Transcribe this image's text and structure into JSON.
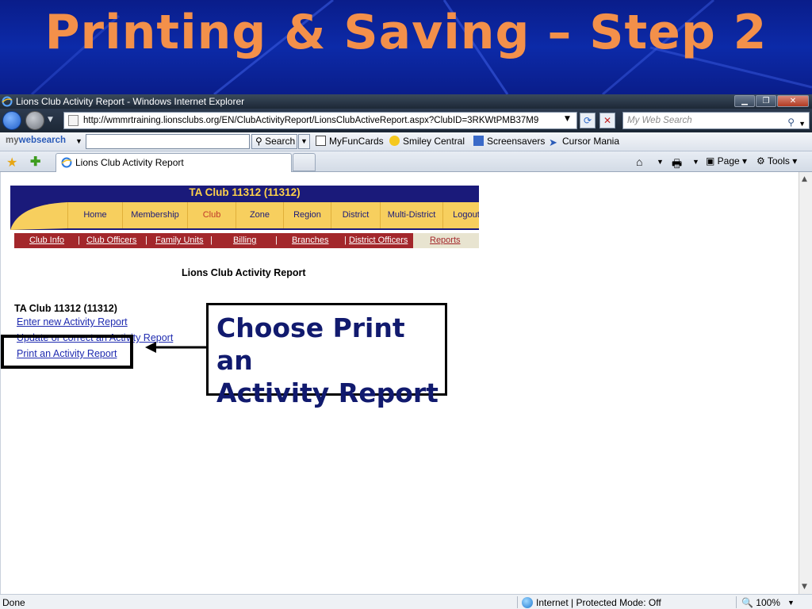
{
  "slide": {
    "title": "Printing & Saving – Step 2"
  },
  "window": {
    "title": "Lions Club Activity Report - Windows Internet Explorer",
    "url": "http://wmmrtraining.lionsclubs.org/EN/ClubActivityReport/LionsClubActiveReport.aspx?ClubID=3RKWtPMB37M9",
    "search_placeholder": "My Web Search"
  },
  "links_bar": {
    "brand_prefix": "my",
    "brand_main": "websearch",
    "search_button": "Search",
    "links": [
      "MyFunCards",
      "Smiley Central",
      "Screensavers",
      "Cursor Mania"
    ]
  },
  "tabs": {
    "active_tab": "Lions Club Activity Report",
    "page_menu": "Page",
    "tools_menu": "Tools"
  },
  "page": {
    "club_header": "TA Club 11312 (11312)",
    "nav": [
      "Home",
      "Membership",
      "Club",
      "Zone",
      "Region",
      "District",
      "Multi-District",
      "Logout"
    ],
    "active_nav": "Club",
    "subnav": [
      "Club Info",
      "Club Officers",
      "Family Units",
      "Billing",
      "Branches",
      "District Officers",
      "Reports"
    ],
    "report_title": "Lions Club Activity Report",
    "club_name": "TA Club 11312 (11312)",
    "links": [
      "Enter new Activity Report",
      "Update or correct an Activity Report",
      "Print an Activity Report"
    ]
  },
  "callout": {
    "line1": "Choose Print an",
    "line2": "Activity Report"
  },
  "status": {
    "left": "Done",
    "zone": "Internet | Protected Mode: Off",
    "zoom": "100%"
  },
  "colors": {
    "banner_bg": "#0c2aa8",
    "title_color": "#f3904a",
    "nav_gold": "#f7cf5e",
    "nav_navy": "#1a1a7a",
    "subnav_red": "#a3272b"
  }
}
